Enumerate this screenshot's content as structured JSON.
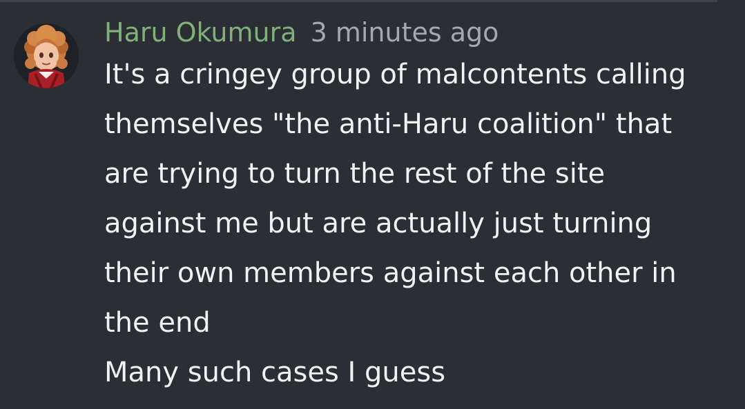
{
  "comment": {
    "author": "Haru Okumura",
    "timestamp": "3 minutes ago",
    "lines": [
      "It's a cringey group of malcontents calling",
      "themselves \"the anti-Haru coalition\" that",
      "are trying to turn the rest of the site",
      "against me but are actually just turning",
      "their own members against each other in",
      "the end",
      "Many such cases I guess"
    ]
  },
  "colors": {
    "background": "#2b2e35",
    "username": "#7fb179",
    "timestamp": "#a5a8ae",
    "text": "#f1f2f4"
  },
  "icons": {
    "avatar": "avatar-icon"
  }
}
